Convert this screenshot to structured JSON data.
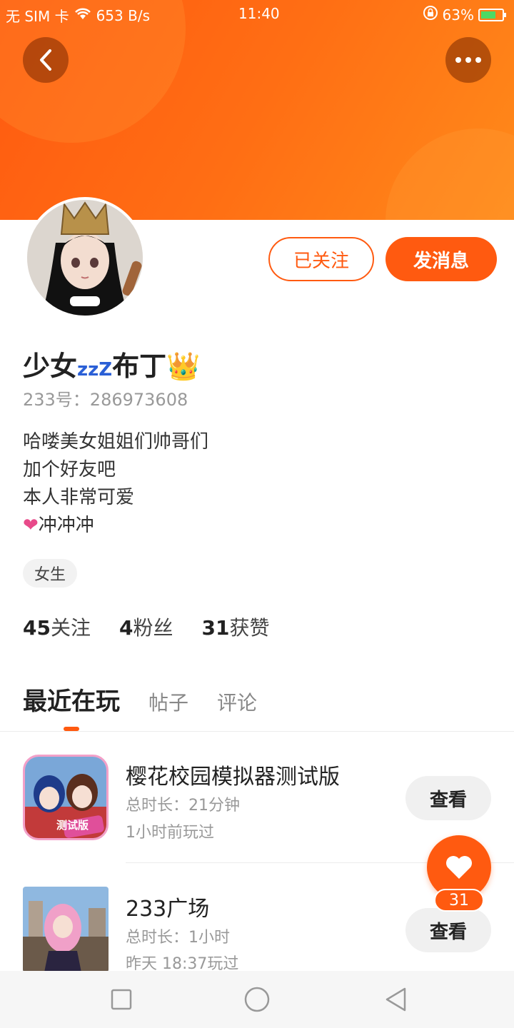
{
  "status_bar": {
    "carrier": "无 SIM 卡",
    "net_speed": "653 B/s",
    "time": "11:40",
    "battery": "63%"
  },
  "header": {
    "back_icon": "chevron-left-icon",
    "more_icon": "more-dots-icon",
    "accent_color": "#ff5a10"
  },
  "profile": {
    "nickname": "少女",
    "nickname_zzz": "zzZ",
    "nickname_tail": "布丁",
    "nickname_emoji": "👑",
    "uid": "233号：286973608",
    "bio": [
      "哈喽美女姐姐们帅哥们",
      "加个好友吧",
      "本人非常可爱"
    ],
    "bio_last_heart": "❤",
    "bio_last": "冲冲冲",
    "tag": "女生"
  },
  "actions": {
    "followed": "已关注",
    "message": "发消息"
  },
  "stats": {
    "following_num": "45",
    "following_label": "关注",
    "fans_num": "4",
    "fans_label": "粉丝",
    "likes_num": "31",
    "likes_label": "获赞"
  },
  "tabs": [
    "最近在玩",
    "帖子",
    "评论"
  ],
  "games": [
    {
      "title": "樱花校园模拟器测试版",
      "duration": "总时长：21分钟",
      "last_played": "1小时前玩过",
      "view_label": "查看",
      "icon_badge": "测试版"
    },
    {
      "title": "233广场",
      "duration": "总时长：1小时",
      "last_played": "昨天 18:37玩过",
      "view_label": "查看"
    }
  ],
  "like_fab": {
    "icon": "heart-icon",
    "count": "31"
  },
  "nav": {
    "recent_icon": "square-icon",
    "home_icon": "circle-icon",
    "back_icon": "triangle-back-icon"
  }
}
